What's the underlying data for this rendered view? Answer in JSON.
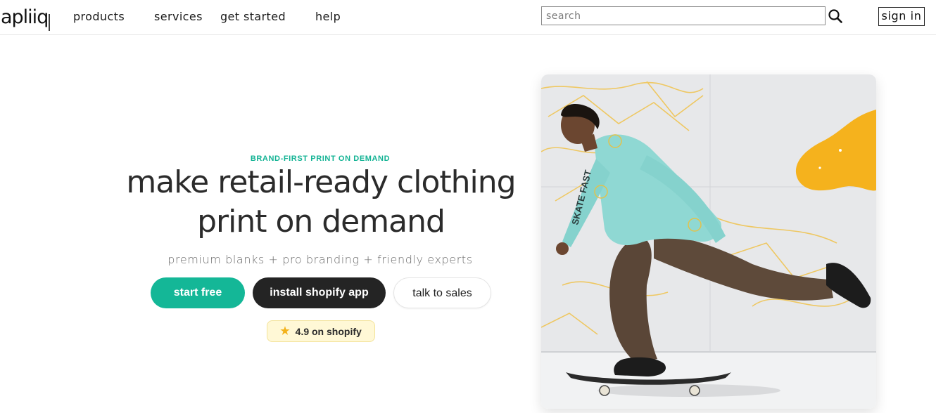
{
  "header": {
    "logo_text": "apliiq",
    "nav": [
      {
        "label": "products"
      },
      {
        "label": "services"
      },
      {
        "label": "get started"
      },
      {
        "label": "help"
      }
    ],
    "search": {
      "placeholder": "search",
      "value": ""
    },
    "signin_label": "sign in"
  },
  "hero": {
    "eyebrow": "BRAND-FIRST PRINT ON DEMAND",
    "headline_line1": "make retail-ready clothing",
    "headline_line2": "print on demand",
    "subline": "premium blanks + pro branding + friendly experts",
    "buttons": {
      "start_free": "start free",
      "install_shopify": "install shopify app",
      "talk_to_sales": "talk to sales"
    },
    "rating": {
      "icon": "star-icon",
      "text": "4.9 on shopify"
    }
  },
  "colors": {
    "accent": "#14b797",
    "dark_button": "#242424",
    "rating_bg": "#fff8d6",
    "star": "#f3b21a"
  }
}
